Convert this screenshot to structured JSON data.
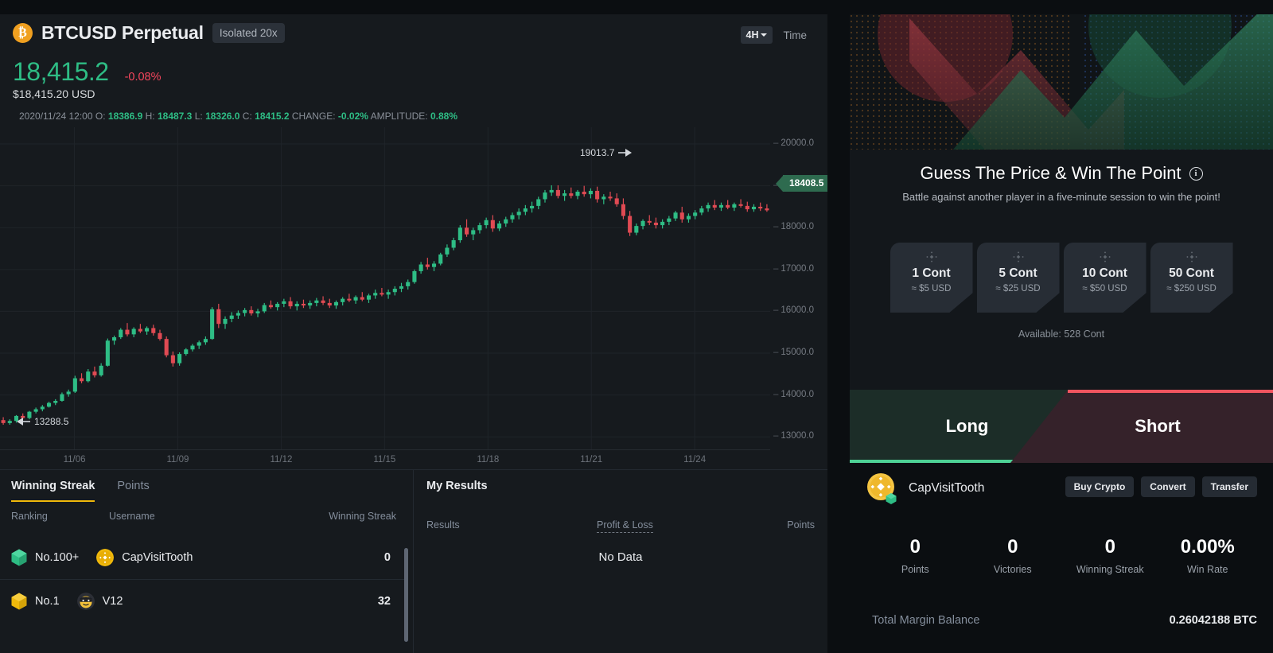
{
  "chart_header": {
    "coin_icon": "bitcoin-icon",
    "symbol": "BTCUSD Perpetual",
    "leverage_badge": "Isolated 20x",
    "last_price": "18,415.2",
    "change_pct": "-0.08%",
    "usd_price": "$18,415.20 USD",
    "timeframe": "4H",
    "time_label": "Time",
    "ohlc": {
      "datetime": "2020/11/24 12:00",
      "o_label": "O:",
      "o": "18386.9",
      "h_label": "H:",
      "h": "18487.3",
      "l_label": "L:",
      "l": "18326.0",
      "c_label": "C:",
      "c": "18415.2",
      "change_label": "CHANGE:",
      "change": "-0.02%",
      "amplitude_label": "AMPLITUDE:",
      "amplitude": "0.88%"
    }
  },
  "chart_data": {
    "type": "candlestick",
    "title": "BTCUSD Perpetual",
    "xlabel": "",
    "ylabel": "",
    "grid": true,
    "ylim": [
      12700,
      20400
    ],
    "yticks": [
      "20000.0",
      "19000.0",
      "18000.0",
      "17000.0",
      "16000.0",
      "15000.0",
      "14000.0",
      "13000.0"
    ],
    "xticks": [
      "11/06",
      "11/09",
      "11/12",
      "11/15",
      "11/18",
      "11/21",
      "11/24"
    ],
    "current_price_tag": "18408.5",
    "high_marker": "19013.7",
    "low_marker": "13288.5",
    "up_color": "#2ebd85",
    "down_color": "#e04a53",
    "candles": [
      [
        13400,
        13470,
        13290,
        13330
      ],
      [
        13330,
        13420,
        13289,
        13380
      ],
      [
        13380,
        13520,
        13340,
        13500
      ],
      [
        13500,
        13560,
        13430,
        13450
      ],
      [
        13450,
        13620,
        13420,
        13600
      ],
      [
        13600,
        13700,
        13560,
        13660
      ],
      [
        13660,
        13760,
        13610,
        13720
      ],
      [
        13720,
        13840,
        13700,
        13810
      ],
      [
        13810,
        13900,
        13760,
        13860
      ],
      [
        13860,
        14060,
        13840,
        14020
      ],
      [
        14020,
        14130,
        13960,
        14080
      ],
      [
        14080,
        14460,
        14050,
        14400
      ],
      [
        14400,
        14520,
        14280,
        14330
      ],
      [
        14330,
        14620,
        14300,
        14560
      ],
      [
        14560,
        14680,
        14420,
        14470
      ],
      [
        14470,
        14760,
        14440,
        14700
      ],
      [
        14700,
        15350,
        14680,
        15300
      ],
      [
        15300,
        15420,
        15200,
        15380
      ],
      [
        15380,
        15600,
        15340,
        15560
      ],
      [
        15560,
        15720,
        15400,
        15450
      ],
      [
        15450,
        15620,
        15380,
        15580
      ],
      [
        15580,
        15700,
        15480,
        15520
      ],
      [
        15520,
        15640,
        15440,
        15600
      ],
      [
        15600,
        15680,
        15420,
        15480
      ],
      [
        15480,
        15560,
        15300,
        15340
      ],
      [
        15340,
        15400,
        14900,
        14950
      ],
      [
        14950,
        15040,
        14680,
        14760
      ],
      [
        14760,
        15020,
        14700,
        14980
      ],
      [
        14980,
        15120,
        14940,
        15090
      ],
      [
        15090,
        15220,
        15040,
        15180
      ],
      [
        15180,
        15300,
        15100,
        15260
      ],
      [
        15260,
        15400,
        15200,
        15340
      ],
      [
        15340,
        16100,
        15320,
        16050
      ],
      [
        16050,
        16180,
        15600,
        15700
      ],
      [
        15700,
        15880,
        15580,
        15820
      ],
      [
        15820,
        15980,
        15740,
        15900
      ],
      [
        15900,
        16020,
        15820,
        15960
      ],
      [
        15960,
        16080,
        15880,
        16030
      ],
      [
        16030,
        16120,
        15900,
        15950
      ],
      [
        15950,
        16060,
        15860,
        16000
      ],
      [
        16000,
        16200,
        15960,
        16150
      ],
      [
        16150,
        16260,
        16060,
        16100
      ],
      [
        16100,
        16220,
        16020,
        16180
      ],
      [
        16180,
        16300,
        16100,
        16240
      ],
      [
        16240,
        16340,
        16060,
        16120
      ],
      [
        16120,
        16240,
        16020,
        16180
      ],
      [
        16180,
        16280,
        16080,
        16140
      ],
      [
        16140,
        16260,
        16060,
        16200
      ],
      [
        16200,
        16320,
        16120,
        16260
      ],
      [
        16260,
        16360,
        16150,
        16200
      ],
      [
        16200,
        16300,
        16080,
        16140
      ],
      [
        16140,
        16260,
        16060,
        16220
      ],
      [
        16220,
        16340,
        16140,
        16300
      ],
      [
        16300,
        16420,
        16220,
        16260
      ],
      [
        16260,
        16380,
        16180,
        16340
      ],
      [
        16340,
        16460,
        16240,
        16280
      ],
      [
        16280,
        16420,
        16200,
        16380
      ],
      [
        16380,
        16520,
        16300,
        16440
      ],
      [
        16440,
        16560,
        16360,
        16400
      ],
      [
        16400,
        16520,
        16300,
        16460
      ],
      [
        16460,
        16600,
        16380,
        16540
      ],
      [
        16540,
        16680,
        16460,
        16600
      ],
      [
        16600,
        16760,
        16520,
        16700
      ],
      [
        16700,
        17000,
        16660,
        16960
      ],
      [
        16960,
        17180,
        16900,
        17120
      ],
      [
        17120,
        17280,
        17000,
        17060
      ],
      [
        17060,
        17200,
        16960,
        17140
      ],
      [
        17140,
        17400,
        17100,
        17360
      ],
      [
        17360,
        17600,
        17300,
        17520
      ],
      [
        17520,
        17760,
        17460,
        17700
      ],
      [
        17700,
        18060,
        17640,
        18000
      ],
      [
        18000,
        18200,
        17780,
        17840
      ],
      [
        17840,
        18000,
        17700,
        17940
      ],
      [
        17940,
        18120,
        17860,
        18060
      ],
      [
        18060,
        18240,
        17980,
        18180
      ],
      [
        18180,
        18300,
        17900,
        17980
      ],
      [
        17980,
        18160,
        17920,
        18100
      ],
      [
        18100,
        18260,
        18020,
        18200
      ],
      [
        18200,
        18360,
        18120,
        18300
      ],
      [
        18300,
        18460,
        18200,
        18380
      ],
      [
        18380,
        18540,
        18300,
        18460
      ],
      [
        18460,
        18620,
        18360,
        18520
      ],
      [
        18520,
        18740,
        18440,
        18680
      ],
      [
        18680,
        18900,
        18600,
        18840
      ],
      [
        18840,
        19013,
        18760,
        18900
      ],
      [
        18900,
        19013,
        18700,
        18760
      ],
      [
        18760,
        18900,
        18640,
        18820
      ],
      [
        18820,
        18960,
        18700,
        18760
      ],
      [
        18760,
        18900,
        18680,
        18860
      ],
      [
        18860,
        19000,
        18740,
        18800
      ],
      [
        18800,
        18940,
        18700,
        18880
      ],
      [
        18880,
        18980,
        18600,
        18680
      ],
      [
        18680,
        18800,
        18560,
        18740
      ],
      [
        18740,
        18860,
        18640,
        18700
      ],
      [
        18700,
        18820,
        18500,
        18560
      ],
      [
        18560,
        18700,
        18200,
        18280
      ],
      [
        18280,
        18400,
        17800,
        17880
      ],
      [
        17880,
        18100,
        17820,
        18040
      ],
      [
        18040,
        18200,
        17960,
        18160
      ],
      [
        18160,
        18300,
        18060,
        18120
      ],
      [
        18120,
        18240,
        17980,
        18060
      ],
      [
        18060,
        18200,
        17980,
        18140
      ],
      [
        18140,
        18280,
        18060,
        18220
      ],
      [
        18220,
        18400,
        18160,
        18360
      ],
      [
        18360,
        18500,
        18120,
        18200
      ],
      [
        18200,
        18340,
        18120,
        18280
      ],
      [
        18280,
        18420,
        18200,
        18360
      ],
      [
        18360,
        18520,
        18300,
        18460
      ],
      [
        18460,
        18600,
        18380,
        18540
      ],
      [
        18540,
        18660,
        18420,
        18480
      ],
      [
        18480,
        18600,
        18400,
        18540
      ],
      [
        18540,
        18660,
        18440,
        18480
      ],
      [
        18480,
        18600,
        18400,
        18560
      ],
      [
        18560,
        18680,
        18480,
        18520
      ],
      [
        18520,
        18620,
        18380,
        18440
      ],
      [
        18440,
        18560,
        18380,
        18500
      ],
      [
        18500,
        18600,
        18400,
        18460
      ],
      [
        18460,
        18560,
        18380,
        18415
      ]
    ]
  },
  "leaderboard": {
    "tabs": [
      {
        "label": "Winning Streak",
        "active": true
      },
      {
        "label": "Points",
        "active": false
      }
    ],
    "columns": {
      "ranking": "Ranking",
      "username": "Username",
      "value": "Winning Streak"
    },
    "rows": [
      {
        "rank": "No.100+",
        "rank_color": "#2ebd85",
        "username": "CapVisitTooth",
        "avatar": "binance-coin-avatar",
        "value": "0"
      },
      {
        "rank": "No.1",
        "rank_color": "#f0b90b",
        "username": "V12",
        "avatar": "cool-face-avatar",
        "value": "32"
      }
    ]
  },
  "my_results": {
    "title": "My Results",
    "columns": {
      "results": "Results",
      "pnl": "Profit & Loss",
      "points": "Points"
    },
    "empty_text": "No Data"
  },
  "game": {
    "title": "Guess The Price & Win The Point",
    "info_icon": "info-icon",
    "subtitle": "Battle against another player in a five-minute session to win the point!",
    "contracts": [
      {
        "amount": "1 Cont",
        "usd": "≈ $5 USD"
      },
      {
        "amount": "5 Cont",
        "usd": "≈ $25 USD"
      },
      {
        "amount": "10 Cont",
        "usd": "≈ $50 USD"
      },
      {
        "amount": "50 Cont",
        "usd": "≈ $250 USD"
      }
    ],
    "available": "Available: 528 Cont",
    "long_label": "Long",
    "short_label": "Short",
    "long_color": "#4ed195",
    "short_color": "#f2555f"
  },
  "account": {
    "username": "CapVisitTooth",
    "avatar": "binance-coin-avatar",
    "buttons": [
      "Buy Crypto",
      "Convert",
      "Transfer"
    ],
    "stats": [
      {
        "value": "0",
        "label": "Points"
      },
      {
        "value": "0",
        "label": "Victories"
      },
      {
        "value": "0",
        "label": "Winning Streak"
      },
      {
        "value": "0.00%",
        "label": "Win Rate"
      }
    ],
    "balance_label": "Total Margin Balance",
    "balance_value": "0.26042188 BTC"
  }
}
